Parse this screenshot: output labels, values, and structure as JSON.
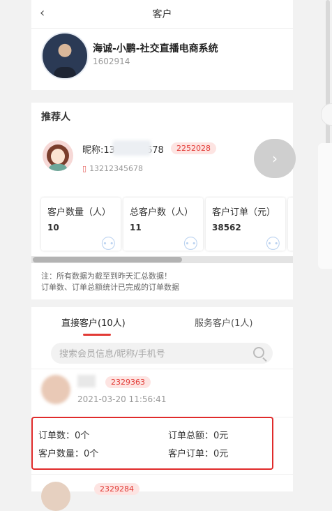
{
  "nav": {
    "title": "客户",
    "back_icon": "chevron-left-icon"
  },
  "profile": {
    "name": "海诚-小鹏-社交直播电商系统",
    "id": "1602914"
  },
  "referrer": {
    "section_title": "推荐人",
    "nickname_prefix": "昵称:13",
    "nickname_suffix": "678",
    "code": "2252028",
    "phone": "13212345678",
    "more_icon": "chevron-right-icon"
  },
  "stats": [
    {
      "label": "客户数量（人）",
      "value": "10"
    },
    {
      "label": "总客户数（人）",
      "value": "11"
    },
    {
      "label": "客户订单（元）",
      "value": "38562"
    }
  ],
  "notes": [
    "注：所有数据为截至到昨天汇总数据！",
    "订单数、订单总额统计已完成的订单数据"
  ],
  "tabs": {
    "direct": "直接客户(10人)",
    "service": "服务客户(1人)"
  },
  "search": {
    "placeholder": "搜索会员信息/昵称/手机号"
  },
  "customers": [
    {
      "code": "2329363",
      "time": "2021-03-20 11:56:41",
      "order_count": "订单数：0个",
      "order_total": "订单总额：0元",
      "customer_count": "客户数量：0个",
      "customer_orders": "客户订单：0元"
    },
    {
      "code": "2329284"
    }
  ],
  "colors": {
    "accent": "#e23b36",
    "tag_bg": "#fde4e2",
    "highlight_border": "#e02b2b"
  }
}
